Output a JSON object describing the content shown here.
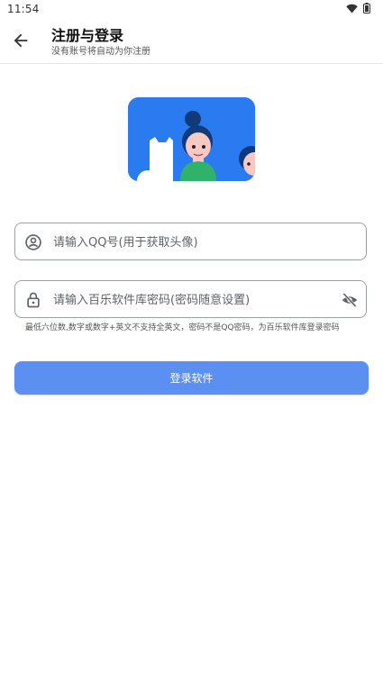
{
  "status_bar": {
    "time": "11:54"
  },
  "app_bar": {
    "title": "注册与登录",
    "subtitle": "没有账号将自动为你注册"
  },
  "form": {
    "qq_field": {
      "placeholder": "请输入QQ号(用于获取头像)",
      "value": ""
    },
    "password_field": {
      "placeholder": "请输入百乐软件库密码(密码随意设置)",
      "value": ""
    },
    "hint": "最低六位数,数字或数字+英文不支持全英文，密码不是QQ密码，为百乐软件库登录密码",
    "login_button": "登录软件"
  },
  "colors": {
    "accent": "#5b8ff2",
    "illustration_bg": "#2b7bf0"
  },
  "icons": {
    "back": "arrow-left-icon",
    "qq_field": "account-circle-icon",
    "password_field": "lock-icon",
    "visibility": "eye-off-icon",
    "wifi": "wifi-icon",
    "battery": "battery-icon"
  }
}
